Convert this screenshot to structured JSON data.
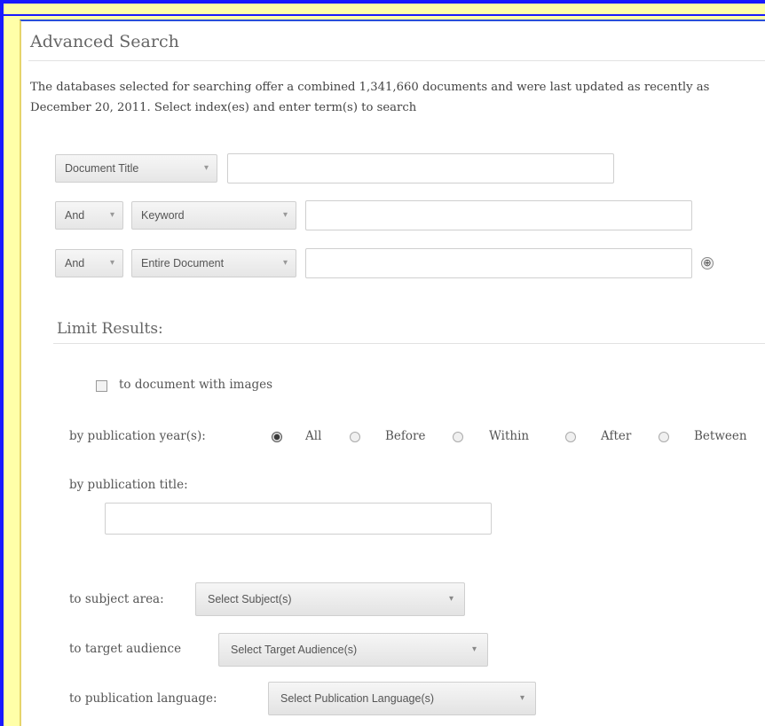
{
  "search": {
    "title": "Advanced Search",
    "description": "The databases selected for searching offer a combined 1,341,660 documents and were last updated as recently as December 20, 2011. Select index(es) and enter term(s) to search",
    "rows": [
      {
        "index": "Document Title",
        "value": ""
      },
      {
        "operator": "And",
        "index": "Keyword",
        "value": ""
      },
      {
        "operator": "And",
        "index": "Entire Document",
        "value": ""
      }
    ],
    "caret": "▾",
    "add_icon": "⊕"
  },
  "limits": {
    "title": "Limit Results:",
    "images_label": "to document with images",
    "images_checked": false,
    "year_label": "by publication year(s):",
    "year_options": [
      "All",
      "Before",
      "Within",
      "After",
      "Between"
    ],
    "year_selected": "All",
    "pubtitle_label": "by publication title:",
    "pubtitle_value": "",
    "subject_label": "to subject area:",
    "subject_value": "Select Subject(s)",
    "audience_label": "to target audience",
    "audience_value": "Select Target Audience(s)",
    "language_label": "to publication language:",
    "language_value": "Select Publication Language(s)"
  }
}
